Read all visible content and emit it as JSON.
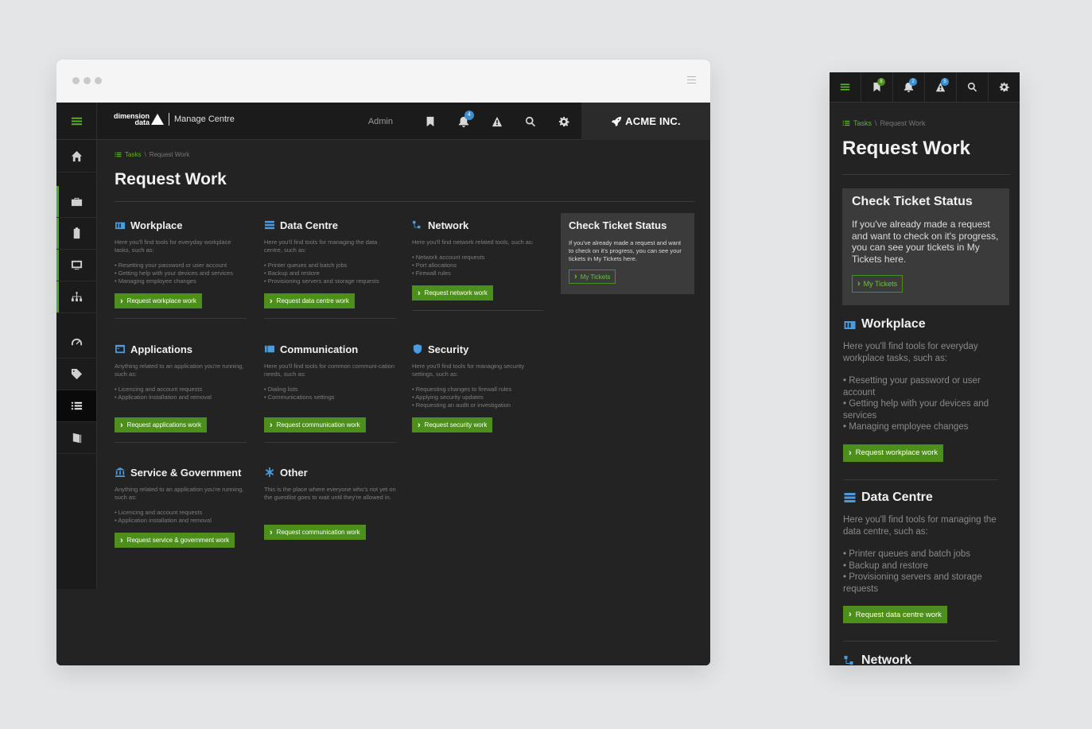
{
  "brand": {
    "logo_top": "dimension",
    "logo_bottom": "data",
    "app_name": "Manage Centre",
    "company": "ACME INC."
  },
  "topnav": {
    "admin_label": "Admin",
    "notifications_count": "4"
  },
  "breadcrumb": {
    "root": "Tasks",
    "separator": "\\",
    "current": "Request Work"
  },
  "page_title": "Request Work",
  "status_panel": {
    "title": "Check Ticket Status",
    "description": "If you've already made a request and want to check on it's progress, you can see your tickets in My Tickets here.",
    "button": "My Tickets"
  },
  "cards": [
    {
      "title": "Workplace",
      "desc": "Here you'll find tools for everyday workplace tasks, such as:",
      "items": [
        "Resetting your password or user account",
        "Getting help with your devices and services",
        "Managing employee changes"
      ],
      "button": "Request workplace work"
    },
    {
      "title": "Data Centre",
      "desc": "Here you'll find tools for managing the data centre, such as:",
      "items": [
        "Printer queues and batch jobs",
        "Backup and restore",
        "Provisioning servers and storage requests"
      ],
      "button": "Request data centre work"
    },
    {
      "title": "Network",
      "desc": "Here you'll find network related tools, such as:",
      "items": [
        "Network account requests",
        "Port allocations",
        "Firewall rules"
      ],
      "button": "Request network work"
    },
    {
      "title": "Applications",
      "desc": "Anything related to an application you're running, such as:",
      "items": [
        "Licencing and account requests",
        "Application installation and removal"
      ],
      "button": "Request applications work"
    },
    {
      "title": "Communication",
      "desc": "Here you'll find tools for common communi-cation needs, such as:",
      "items": [
        "Dialing lists",
        "Communications settings"
      ],
      "button": "Request communication work"
    },
    {
      "title": "Security",
      "desc": "Here you'll find tools for managing security settings, such as:",
      "items": [
        "Requesting changes to firewall rules",
        "Applying security updates",
        "Requesting an audit or investigation"
      ],
      "button": "Request security work"
    },
    {
      "title": "Service & Government",
      "desc": "Anything related to an application you're running, such as:",
      "items": [
        "Licencing and account requests",
        "Application installation and removal"
      ],
      "button": "Request service & government work"
    },
    {
      "title": "Other",
      "desc": "This is the place where everyone who's not yet on the guestlist goes to wait until they're allowed in.",
      "items": [],
      "button": "Request communication work"
    }
  ],
  "mobile": {
    "badges": [
      "8",
      "2",
      "5"
    ],
    "workplace_items": [
      "Resetting your password or user account",
      "Getting help with your devices and services",
      "Managing employee changes"
    ],
    "datacentre_items": [
      "Printer queues and batch jobs",
      "Backup and restore",
      "Provisioning servers and storage requests"
    ],
    "workplace_desc": "Here you'll find tools for everyday workplace tasks, such as:",
    "datacentre_desc": "Here you'll find tools for managing the data centre, such as:"
  },
  "colors": {
    "accent_green": "#4c8f1a",
    "icon_blue": "#4a9be0",
    "badge_blue": "#3a8fd1",
    "background": "#232323"
  },
  "icons": [
    "hamburger-icon",
    "home-icon",
    "briefcase-icon",
    "clipboard-icon",
    "monitor-icon",
    "sitemap-icon",
    "gauge-icon",
    "tag-icon",
    "list-icon",
    "book-icon",
    "bookmark-icon",
    "bell-icon",
    "warning-icon",
    "search-icon",
    "gear-icon",
    "rocket-icon"
  ]
}
